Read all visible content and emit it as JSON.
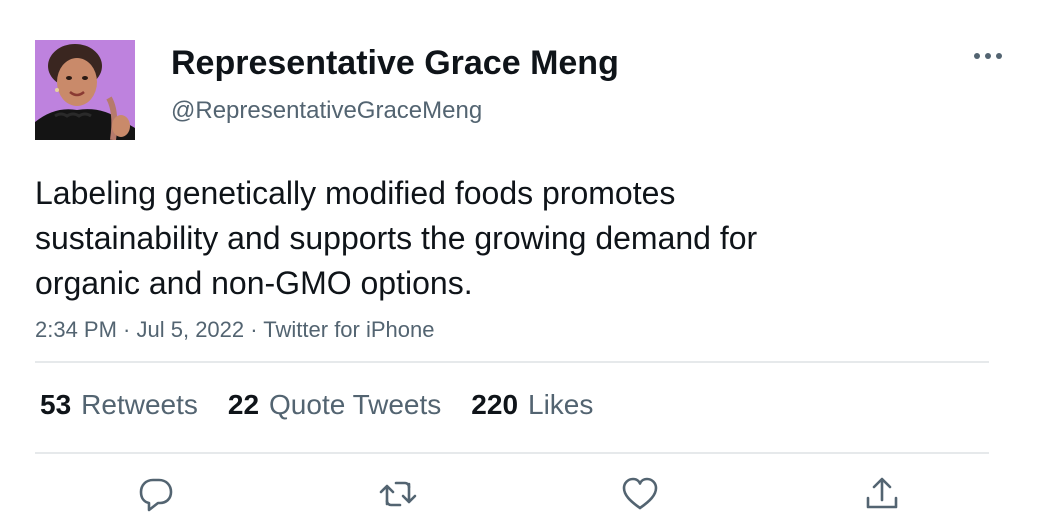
{
  "author": {
    "display_name": "Representative Grace Meng",
    "handle": "@RepresentativeGraceMeng"
  },
  "tweet": {
    "text_lines": [
      "Labeling genetically modified foods promotes",
      "sustainability and supports the growing demand for",
      "organic and non-GMO options."
    ],
    "time": "2:34 PM",
    "date": "Jul 5, 2022",
    "source": "Twitter for iPhone",
    "separator": " · "
  },
  "stats": {
    "retweets": {
      "count": "53",
      "label": "Retweets"
    },
    "quote_tweets": {
      "count": "22",
      "label": "Quote Tweets"
    },
    "likes": {
      "count": "220",
      "label": "Likes"
    }
  },
  "actions": [
    {
      "name": "reply",
      "icon": "reply-icon"
    },
    {
      "name": "retweet",
      "icon": "retweet-icon"
    },
    {
      "name": "like",
      "icon": "heart-icon"
    },
    {
      "name": "share",
      "icon": "share-icon"
    }
  ],
  "menu": {
    "icon": "more-options-icon"
  },
  "colors": {
    "text_primary": "#0f1419",
    "text_secondary": "#536471",
    "divider": "#e6e9eb",
    "avatar_background": "#c58be2"
  }
}
